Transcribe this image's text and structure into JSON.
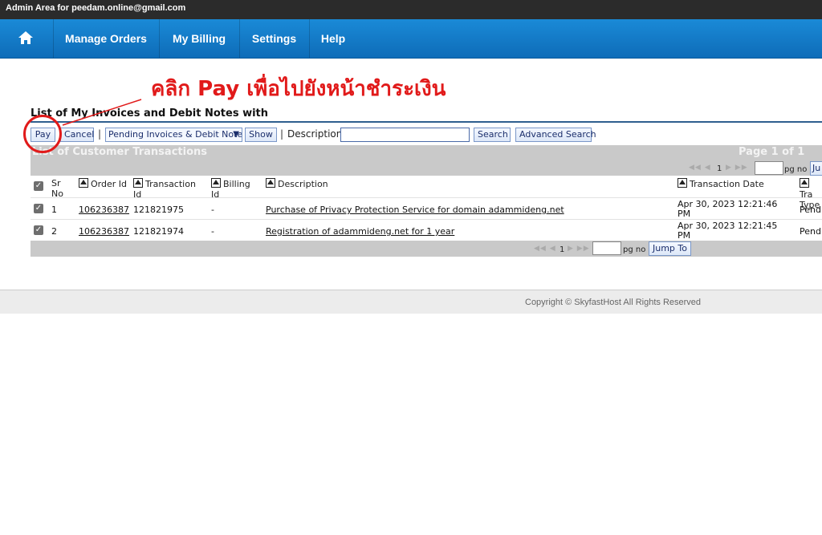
{
  "topbar": {
    "text": "Admin Area for peedam.online@gmail.com"
  },
  "nav": {
    "home_icon": "home-icon",
    "items": [
      {
        "label": "Manage Orders"
      },
      {
        "label": "My Billing"
      },
      {
        "label": "Settings"
      },
      {
        "label": "Help"
      }
    ]
  },
  "annotation": {
    "text": "คลิก Pay เพื่อไปยังหน้าชำระเงิน",
    "color": "#e11a1a"
  },
  "page": {
    "title": "List of My Invoices and Debit Notes with"
  },
  "toolbar": {
    "pay_label": "Pay",
    "cancel_label": "Cancel",
    "separator": "|",
    "filter_selected": "Pending Invoices & Debit Notes",
    "show_label": "Show",
    "description_label": "Description",
    "description_value": "",
    "search_label": "Search",
    "advanced_search_label": "Advanced Search"
  },
  "transactions_bar": {
    "title": "List of Customer Transactions",
    "page_info": "Page 1 of 1",
    "page_number": "1",
    "pg_no_label": "pg no",
    "jump_label": "Jump To",
    "jump_label_cut": "Ju"
  },
  "table": {
    "headers": {
      "sr": "Sr\nNo",
      "order_id": "Order Id",
      "transaction_id": "Transaction\nId",
      "billing_id": "Billing\nId",
      "description": "Description",
      "transaction_date": "Transaction Date",
      "transaction_type": "Tra\nType"
    },
    "rows": [
      {
        "sr": "1",
        "order_id": "106236387",
        "transaction_id": "121821975",
        "billing_id": "-",
        "description": "Purchase of Privacy Protection Service for domain adammideng.net",
        "date_line1": "Apr 30, 2023 12:21:46",
        "date_line2": "PM",
        "type": "Pendi"
      },
      {
        "sr": "2",
        "order_id": "106236387",
        "transaction_id": "121821974",
        "billing_id": "-",
        "description": "Registration of adammideng.net for 1 year",
        "date_line1": "Apr 30, 2023 12:21:45",
        "date_line2": "PM",
        "type": "Pendi"
      }
    ]
  },
  "footer": {
    "text": "Copyright © SkyfastHost All Rights Reserved"
  }
}
